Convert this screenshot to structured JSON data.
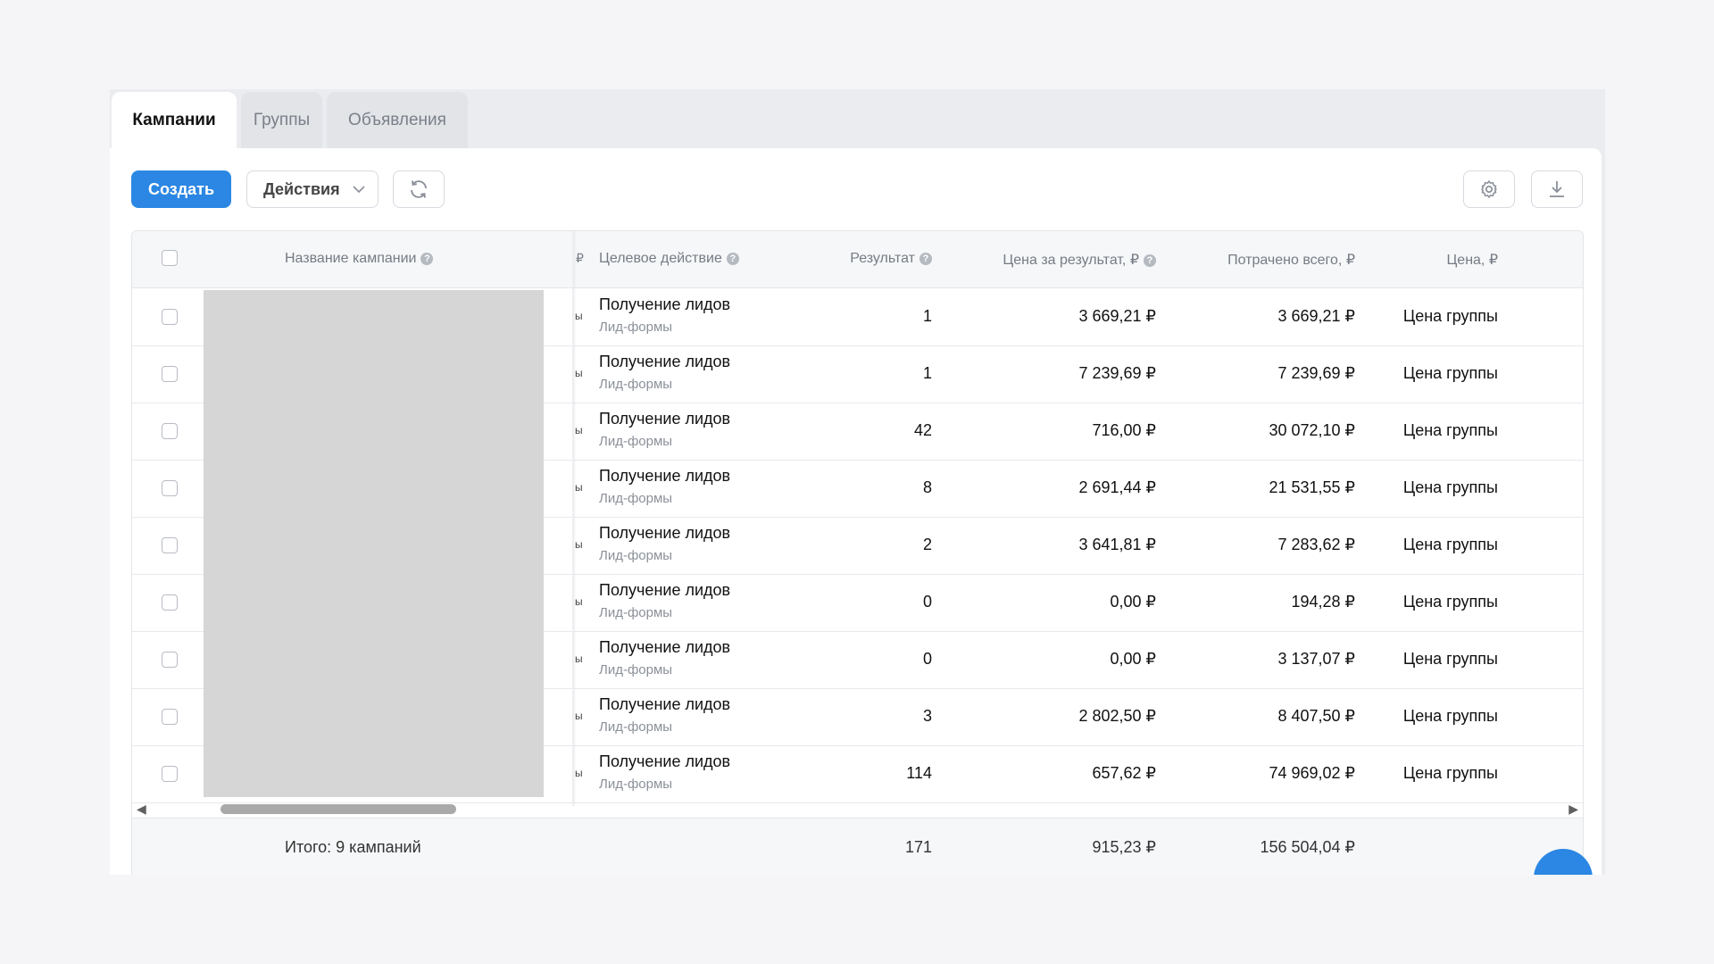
{
  "tabs": [
    {
      "label": "Кампании",
      "active": true
    },
    {
      "label": "Группы",
      "active": false
    },
    {
      "label": "Объявления",
      "active": false
    }
  ],
  "toolbar": {
    "create_label": "Создать",
    "actions_label": "Действия",
    "refresh_icon": "refresh-icon",
    "settings_icon": "gear-icon",
    "download_icon": "download-icon"
  },
  "table": {
    "columns": {
      "name": "Название кампании",
      "cut": "₽",
      "target": "Целевое действие",
      "result": "Результат",
      "cost_per_result": "Цена за результат, ₽",
      "spent": "Потрачено всего, ₽",
      "price": "Цена, ₽"
    },
    "rows": [
      {
        "target": "Получение лидов",
        "target_sub": "Лид-формы",
        "result": "1",
        "cost": "3 669,21 ₽",
        "spent": "3 669,21 ₽",
        "price": "Цена группы"
      },
      {
        "target": "Получение лидов",
        "target_sub": "Лид-формы",
        "result": "1",
        "cost": "7 239,69 ₽",
        "spent": "7 239,69 ₽",
        "price": "Цена группы"
      },
      {
        "target": "Получение лидов",
        "target_sub": "Лид-формы",
        "result": "42",
        "cost": "716,00 ₽",
        "spent": "30 072,10 ₽",
        "price": "Цена группы"
      },
      {
        "target": "Получение лидов",
        "target_sub": "Лид-формы",
        "result": "8",
        "cost": "2 691,44 ₽",
        "spent": "21 531,55 ₽",
        "price": "Цена группы"
      },
      {
        "target": "Получение лидов",
        "target_sub": "Лид-формы",
        "result": "2",
        "cost": "3 641,81 ₽",
        "spent": "7 283,62 ₽",
        "price": "Цена группы"
      },
      {
        "target": "Получение лидов",
        "target_sub": "Лид-формы",
        "result": "0",
        "cost": "0,00 ₽",
        "spent": "194,28 ₽",
        "price": "Цена группы"
      },
      {
        "target": "Получение лидов",
        "target_sub": "Лид-формы",
        "result": "0",
        "cost": "0,00 ₽",
        "spent": "3 137,07 ₽",
        "price": "Цена группы"
      },
      {
        "target": "Получение лидов",
        "target_sub": "Лид-формы",
        "result": "3",
        "cost": "2 802,50 ₽",
        "spent": "8 407,50 ₽",
        "price": "Цена группы"
      },
      {
        "target": "Получение лидов",
        "target_sub": "Лид-формы",
        "result": "114",
        "cost": "657,62 ₽",
        "spent": "74 969,02 ₽",
        "price": "Цена группы"
      }
    ],
    "cut_glyph": "ы",
    "footer": {
      "label": "Итого: 9 кампаний",
      "result": "171",
      "cost": "915,23 ₽",
      "spent": "156 504,04 ₽"
    }
  },
  "colors": {
    "accent": "#2b87e3",
    "redacted": "#d6d6d6"
  }
}
